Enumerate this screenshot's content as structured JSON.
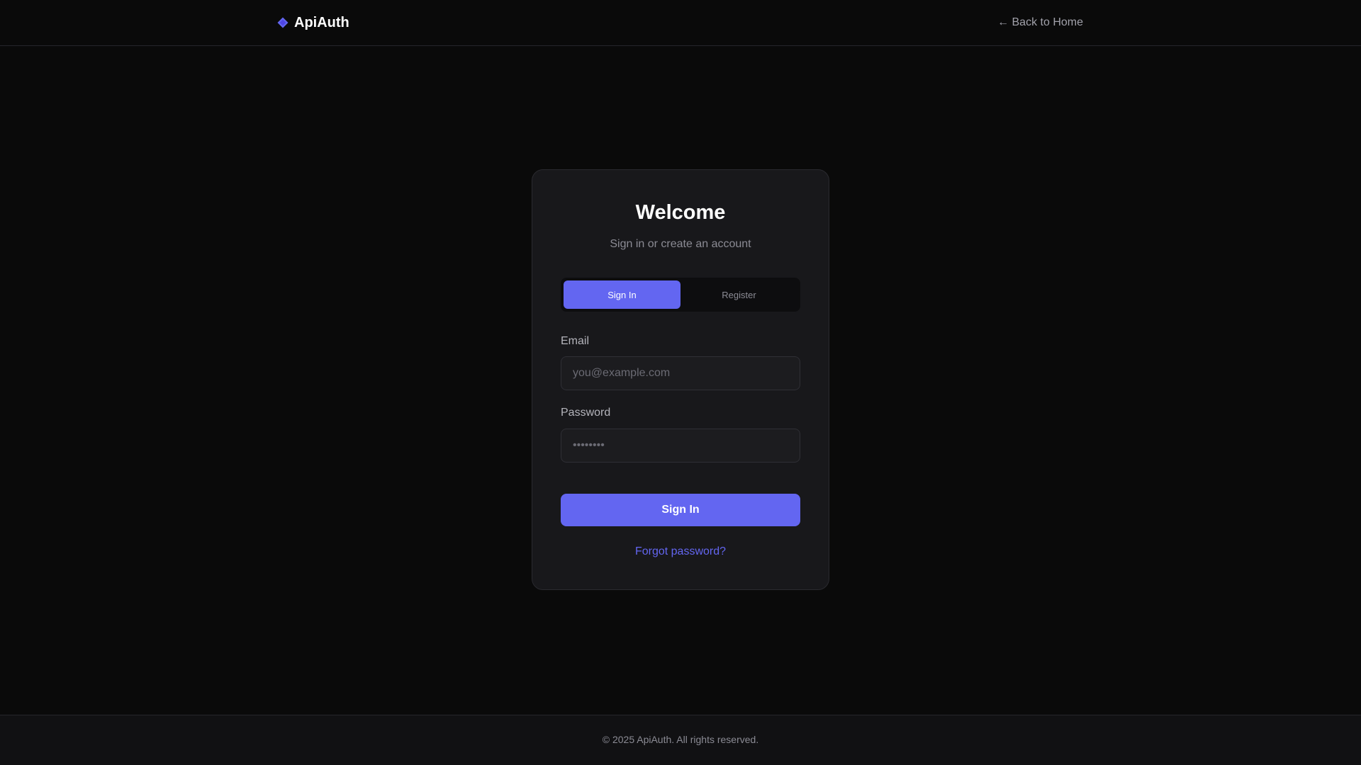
{
  "header": {
    "brand_name": "ApiAuth",
    "brand_icon": "diamond-icon",
    "back_link": "← Back to Home"
  },
  "card": {
    "title": "Welcome",
    "subtitle": "Sign in or create an account",
    "tabs": [
      {
        "label": "Sign In",
        "active": true
      },
      {
        "label": "Register",
        "active": false
      }
    ],
    "email": {
      "label": "Email",
      "placeholder": "you@example.com",
      "value": ""
    },
    "password": {
      "label": "Password",
      "placeholder": "••••••••",
      "value": ""
    },
    "submit_label": "Sign In",
    "forgot_link": "Forgot password?"
  },
  "footer": {
    "text": "© 2025 ApiAuth. All rights reserved."
  },
  "colors": {
    "accent": "#6366f1",
    "background": "#0a0a0a",
    "card": "#18181b",
    "muted_text": "#8b8b94"
  }
}
